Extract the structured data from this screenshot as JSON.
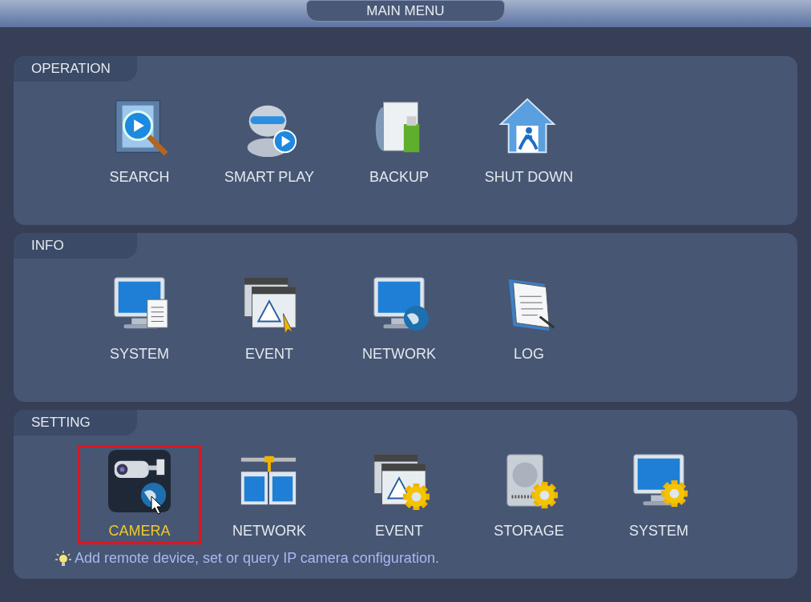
{
  "window": {
    "title": "MAIN MENU"
  },
  "sections": [
    {
      "title": "OPERATION",
      "items": [
        {
          "label": "SEARCH",
          "kind": "film-search",
          "selected": false
        },
        {
          "label": "SMART PLAY",
          "kind": "robot-play",
          "selected": false
        },
        {
          "label": "BACKUP",
          "kind": "backup",
          "selected": false
        },
        {
          "label": "SHUT DOWN",
          "kind": "house-exit",
          "selected": false
        }
      ]
    },
    {
      "title": "INFO",
      "items": [
        {
          "label": "SYSTEM",
          "kind": "monitor-doc",
          "selected": false
        },
        {
          "label": "EVENT",
          "kind": "window-warning",
          "selected": false
        },
        {
          "label": "NETWORK",
          "kind": "monitor-globe",
          "selected": false
        },
        {
          "label": "LOG",
          "kind": "notebook",
          "selected": false
        }
      ]
    },
    {
      "title": "SETTING",
      "items": [
        {
          "label": "CAMERA",
          "kind": "camera-globe",
          "selected": true
        },
        {
          "label": "NETWORK",
          "kind": "network",
          "selected": false
        },
        {
          "label": "EVENT",
          "kind": "window-gear",
          "selected": false
        },
        {
          "label": "STORAGE",
          "kind": "disk-gear",
          "selected": false
        },
        {
          "label": "SYSTEM",
          "kind": "monitor-gear",
          "selected": false
        }
      ],
      "hint": "Add remote device, set or query IP camera configuration."
    }
  ]
}
